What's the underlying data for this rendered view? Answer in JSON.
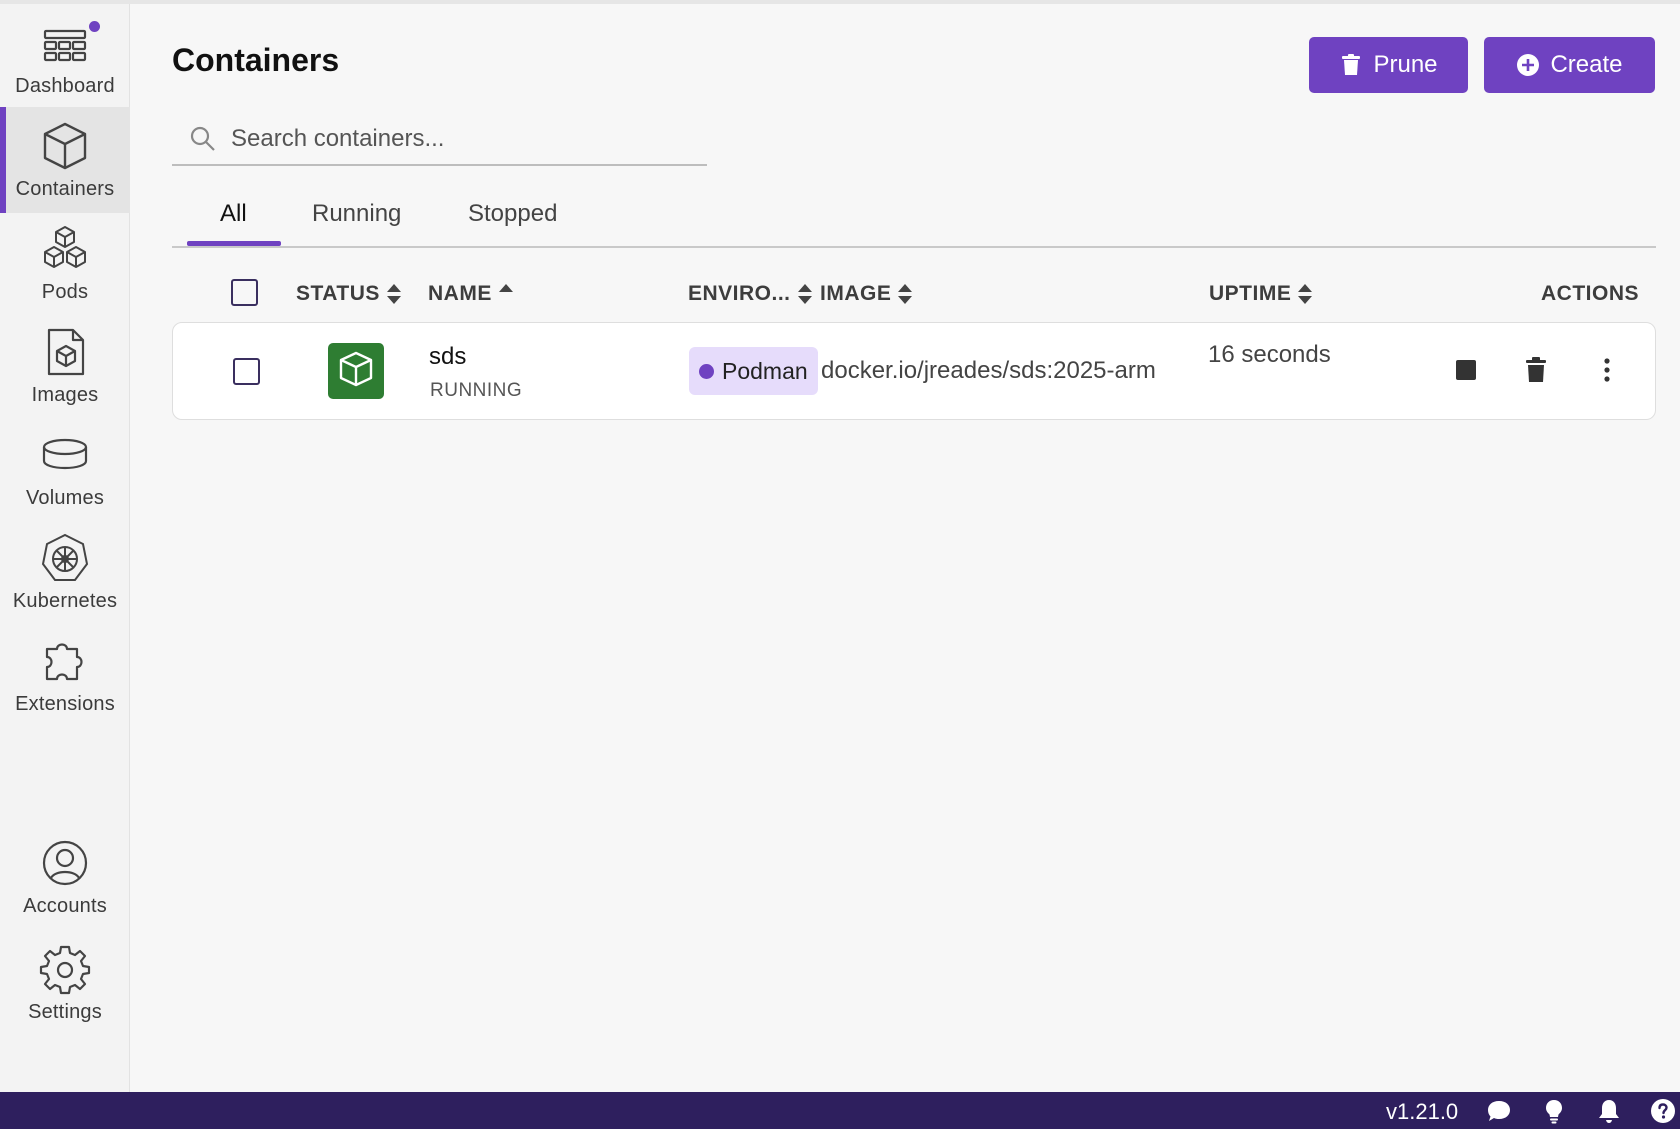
{
  "sidebar": {
    "items": [
      {
        "label": "Dashboard",
        "icon": "dashboard-icon",
        "badge": true
      },
      {
        "label": "Containers",
        "icon": "container-cube-icon",
        "active": true
      },
      {
        "label": "Pods",
        "icon": "pods-icon"
      },
      {
        "label": "Images",
        "icon": "image-file-icon"
      },
      {
        "label": "Volumes",
        "icon": "volume-disk-icon"
      },
      {
        "label": "Kubernetes",
        "icon": "kubernetes-helm-icon"
      },
      {
        "label": "Extensions",
        "icon": "puzzle-piece-icon"
      },
      {
        "label": "Accounts",
        "icon": "account-circle-icon"
      },
      {
        "label": "Settings",
        "icon": "gear-icon"
      }
    ]
  },
  "page": {
    "title": "Containers",
    "prune_label": "Prune",
    "create_label": "Create"
  },
  "search": {
    "placeholder": "Search containers..."
  },
  "tabs": [
    {
      "label": "All",
      "active": true
    },
    {
      "label": "Running"
    },
    {
      "label": "Stopped"
    }
  ],
  "table": {
    "columns": [
      "STATUS",
      "NAME",
      "ENVIRO...",
      "IMAGE",
      "UPTIME",
      "ACTIONS"
    ],
    "rows": [
      {
        "name": "sds",
        "state": "RUNNING",
        "environment": "Podman",
        "image": "docker.io/jreades/sds:2025-arm",
        "uptime": "16 seconds"
      }
    ]
  },
  "statusbar": {
    "version": "v1.21.0",
    "icons": [
      "chat-bubble-icon",
      "lightbulb-icon",
      "bell-icon",
      "help-icon"
    ]
  },
  "colors": {
    "accent": "#6f42c1",
    "running": "#2e7d32",
    "statusbar": "#2e1f5e",
    "env_badge": "#e6dcfb"
  }
}
